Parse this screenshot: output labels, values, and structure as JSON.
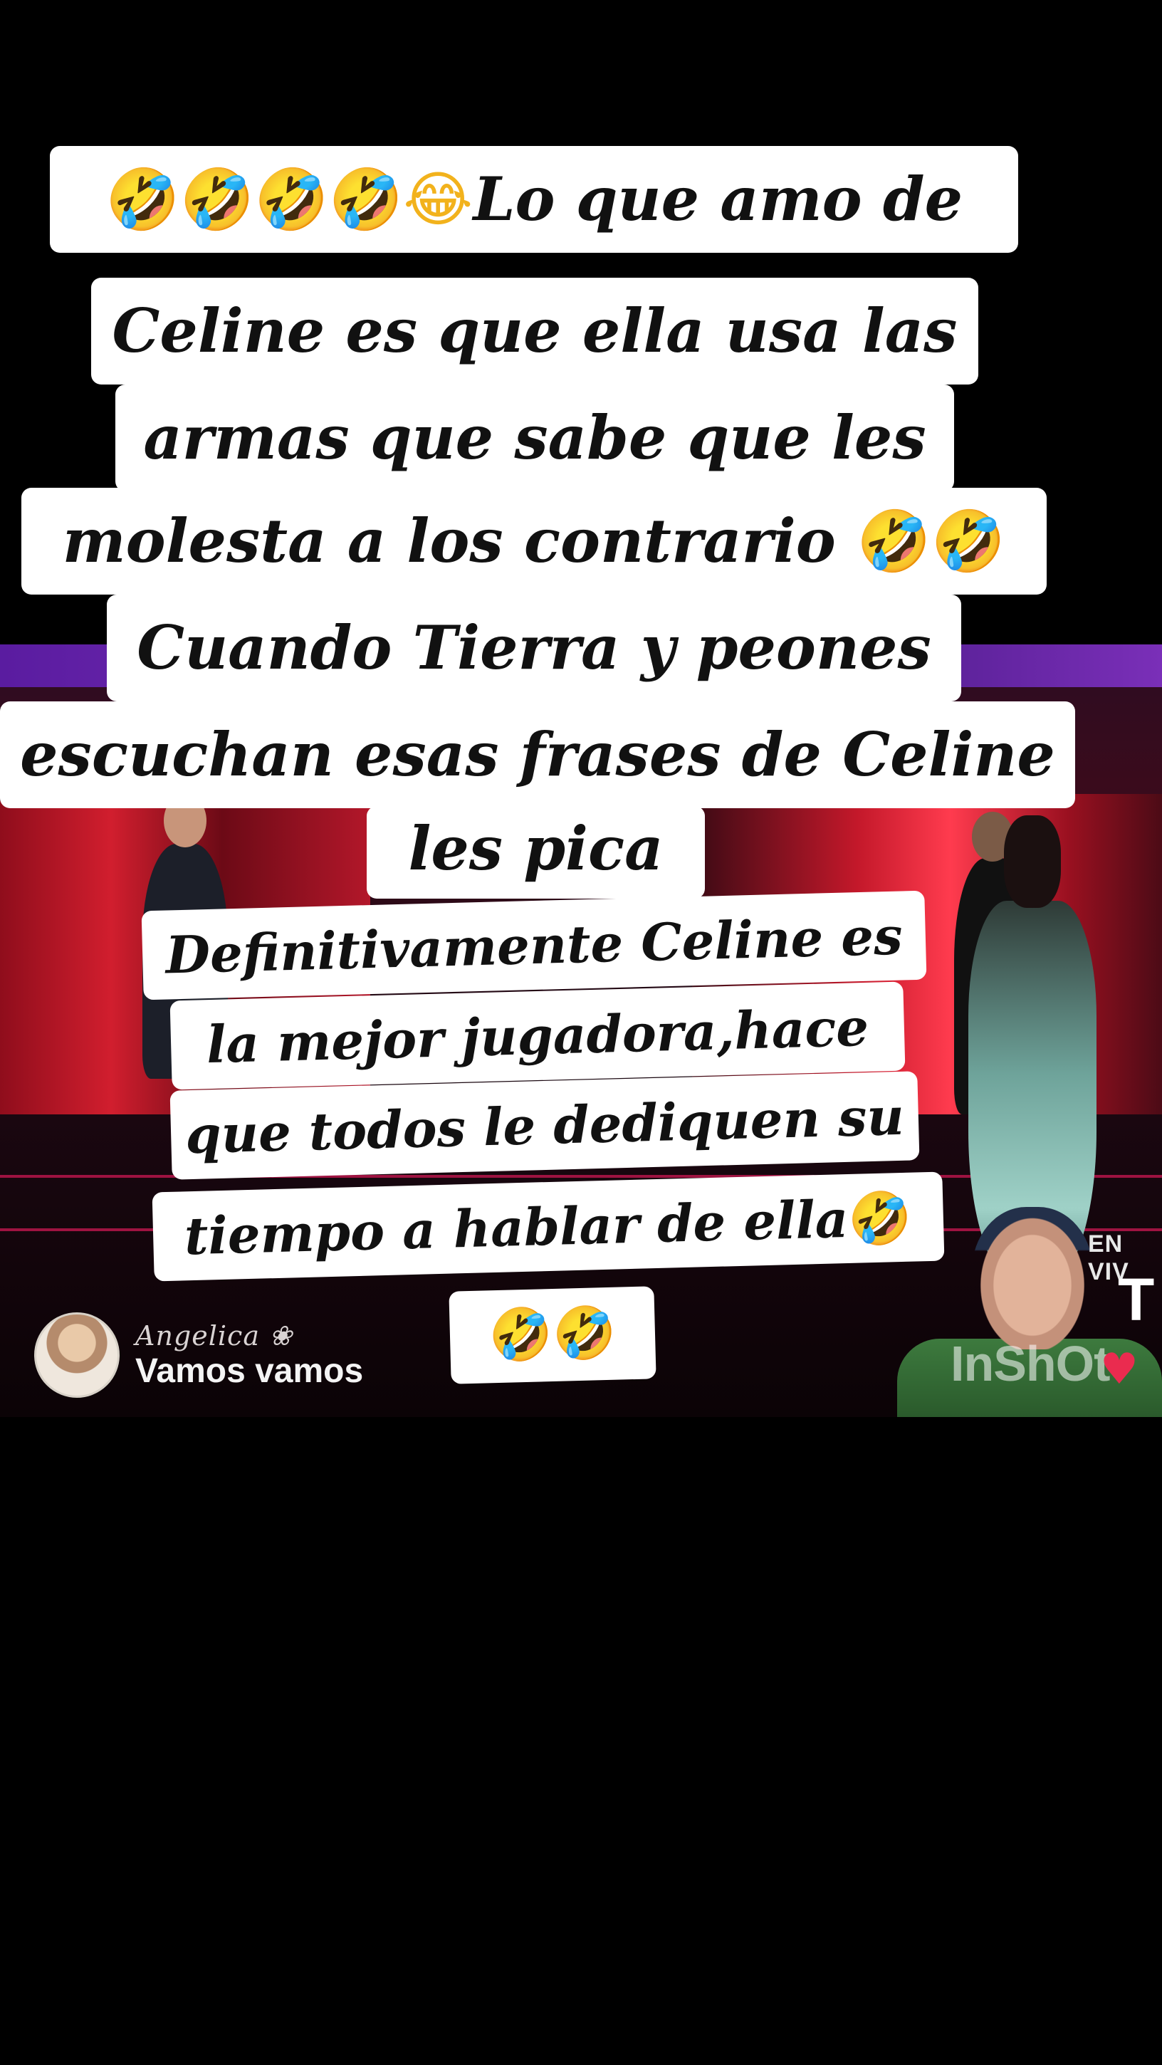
{
  "caption_top": {
    "lines": [
      {
        "emoji": "🤣🤣🤣🤣😂",
        "text": "Lo que amo de"
      },
      {
        "text": "Celine es que ella usa las"
      },
      {
        "text": "armas que sabe que les"
      },
      {
        "text": "molesta a los contrario",
        "emoji": "🤣🤣"
      },
      {
        "text": "Cuando Tierra y peones"
      },
      {
        "text": "escuchan esas frases de Celine"
      },
      {
        "text": "les pica"
      }
    ]
  },
  "caption_bottom": {
    "lines": [
      {
        "text": "Definitivamente Celine es"
      },
      {
        "text": "la mejor jugadora,hace"
      },
      {
        "text": "que todos le dediquen su"
      },
      {
        "text": "tiempo a hablar de ella",
        "emoji": "🤣"
      },
      {
        "emoji": "🤣🤣"
      }
    ]
  },
  "video": {
    "comment": {
      "user": "Angelica ❀",
      "message": "Vamos vamos"
    },
    "channel_tag": "EN VIV",
    "channel_logo": "T",
    "watermark": "InShOt",
    "watermark_heart": "♥"
  },
  "colors": {
    "caption_bg": "#ffffff",
    "caption_text": "#111111",
    "background": "#000000"
  }
}
